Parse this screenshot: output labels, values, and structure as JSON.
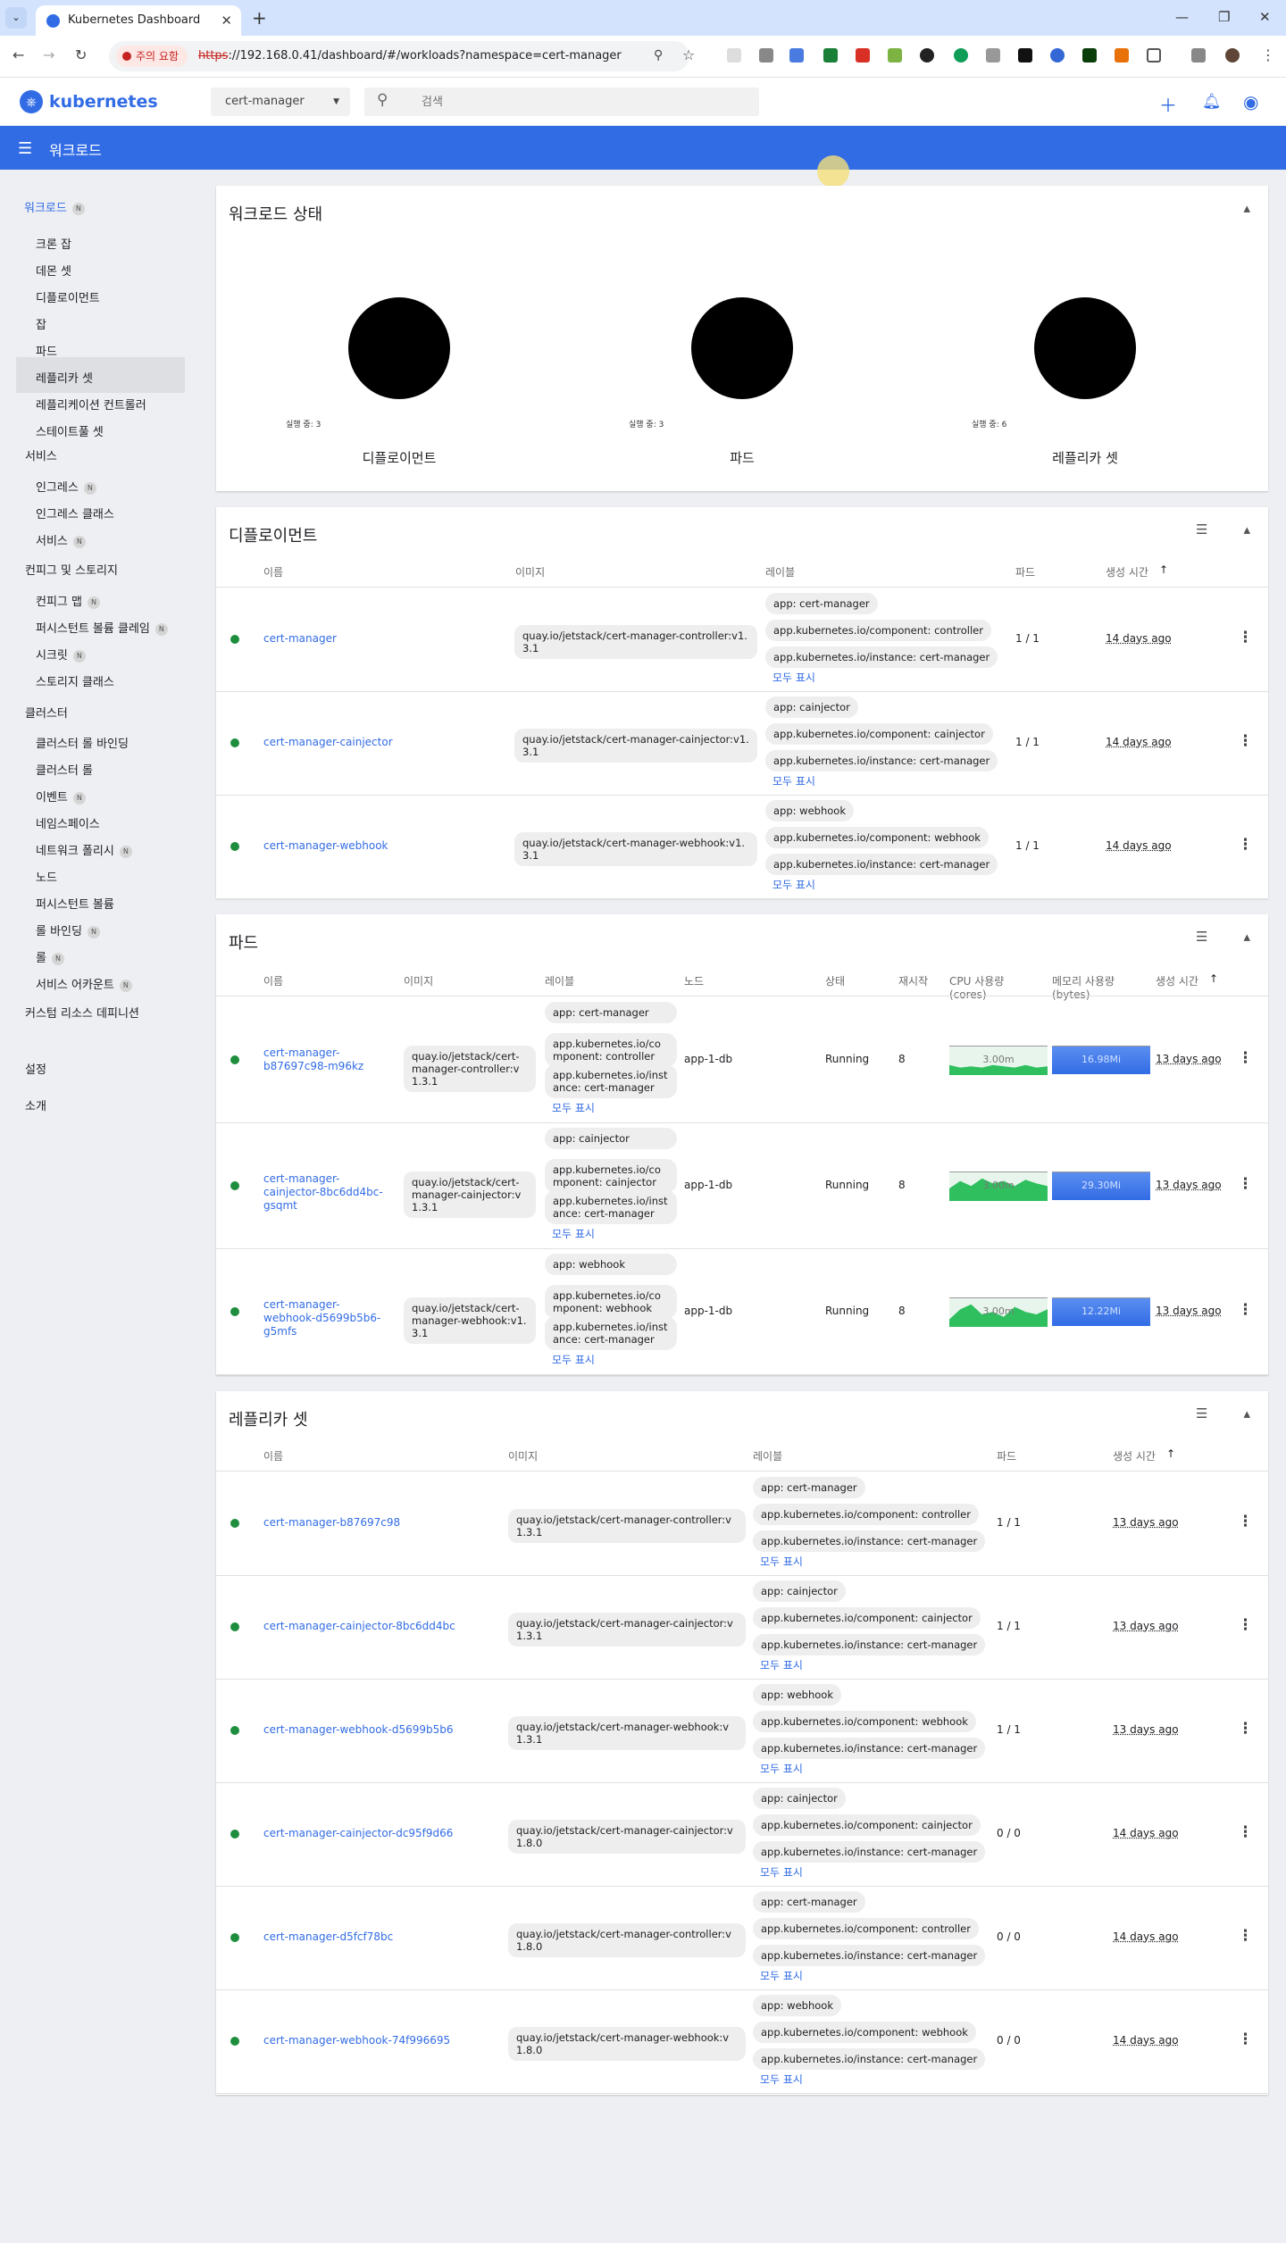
{
  "browser": {
    "tab_title": "Kubernetes Dashboard",
    "warning": "주의 요함",
    "url_scheme": "https",
    "url_rest": "://192.168.0.41/dashboard/#/workloads?namespace=cert-manager"
  },
  "header": {
    "brand": "kubernetes",
    "namespace": "cert-manager",
    "search_placeholder": "검색",
    "page_title": "워크로드"
  },
  "sidebar": {
    "active": "워크로드",
    "workloads_badge": "N",
    "workload_items": [
      "크론 잡",
      "데몬 셋",
      "디플로이먼트",
      "잡",
      "파드",
      "레플리카 셋",
      "레플리케이션 컨트롤러",
      "스테이트풀 셋"
    ],
    "service_header": "서비스",
    "service_items": [
      "인그레스",
      "인그레스 클래스",
      "서비스"
    ],
    "config_header": "컨피그 및 스토리지",
    "config_items": [
      "컨피그 맵",
      "퍼시스턴트 볼륨 클레임",
      "시크릿",
      "스토리지 클래스"
    ],
    "cluster_header": "클러스터",
    "cluster_items": [
      "클러스터 롤 바인딩",
      "클러스터 롤",
      "이벤트",
      "네임스페이스",
      "네트워크 폴리시",
      "노드",
      "퍼시스턴트 볼륨",
      "롤 바인딩",
      "롤",
      "서비스 어카운트"
    ],
    "crd": "커스텀 리소스 데피니션",
    "settings": "설정",
    "about": "소개"
  },
  "status": {
    "title": "워크로드 상태",
    "items": [
      {
        "label": "실행 중: 3",
        "name": "디플로이먼트"
      },
      {
        "label": "실행 중: 3",
        "name": "파드"
      },
      {
        "label": "실행 중: 6",
        "name": "레플리카 셋"
      }
    ]
  },
  "common": {
    "show_all": "모두 표시"
  },
  "deployments": {
    "title": "디플로이먼트",
    "cols": [
      "이름",
      "이미지",
      "레이블",
      "파드",
      "생성 시간"
    ],
    "rows": [
      {
        "name": "cert-manager",
        "image": "quay.io/jetstack/cert-manager-controller:v1.3.1",
        "labels": [
          "app: cert-manager",
          "app.kubernetes.io/component: controller",
          "app.kubernetes.io/instance: cert-manager"
        ],
        "pods": "1 / 1",
        "age": "14 days ago"
      },
      {
        "name": "cert-manager-cainjector",
        "image": "quay.io/jetstack/cert-manager-cainjector:v1.3.1",
        "labels": [
          "app: cainjector",
          "app.kubernetes.io/component: cainjector",
          "app.kubernetes.io/instance: cert-manager"
        ],
        "pods": "1 / 1",
        "age": "14 days ago"
      },
      {
        "name": "cert-manager-webhook",
        "image": "quay.io/jetstack/cert-manager-webhook:v1.3.1",
        "labels": [
          "app: webhook",
          "app.kubernetes.io/component: webhook",
          "app.kubernetes.io/instance: cert-manager"
        ],
        "pods": "1 / 1",
        "age": "14 days ago"
      }
    ]
  },
  "pods": {
    "title": "파드",
    "cols": [
      "이름",
      "이미지",
      "레이블",
      "노드",
      "상태",
      "재시작",
      "CPU 사용량 (cores)",
      "메모리 사용량 (bytes)",
      "생성 시간"
    ],
    "rows": [
      {
        "name": "cert-manager-b87697c98-m96kz",
        "image": "quay.io/jetstack/cert-manager-controller:v1.3.1",
        "labels": [
          "app: cert-manager",
          "app.kubernetes.io/component: controller",
          "app.kubernetes.io/instance: cert-manager"
        ],
        "node": "app-1-db",
        "status": "Running",
        "restarts": "8",
        "cpu": "3.00m",
        "mem": "16.98Mi",
        "age": "13 days ago"
      },
      {
        "name": "cert-manager-cainjector-8bc6dd4bc-gsqmt",
        "image": "quay.io/jetstack/cert-manager-cainjector:v1.3.1",
        "labels": [
          "app: cainjector",
          "app.kubernetes.io/component: cainjector",
          "app.kubernetes.io/instance: cert-manager"
        ],
        "node": "app-1-db",
        "status": "Running",
        "restarts": "8",
        "cpu": "3.00m",
        "mem": "29.30Mi",
        "age": "13 days ago"
      },
      {
        "name": "cert-manager-webhook-d5699b5b6-g5mfs",
        "image": "quay.io/jetstack/cert-manager-webhook:v1.3.1",
        "labels": [
          "app: webhook",
          "app.kubernetes.io/component: webhook",
          "app.kubernetes.io/instance: cert-manager"
        ],
        "node": "app-1-db",
        "status": "Running",
        "restarts": "8",
        "cpu": "3.00m",
        "mem": "12.22Mi",
        "age": "13 days ago"
      }
    ]
  },
  "replicasets": {
    "title": "레플리카 셋",
    "cols": [
      "이름",
      "이미지",
      "레이블",
      "파드",
      "생성 시간"
    ],
    "rows": [
      {
        "name": "cert-manager-b87697c98",
        "image": "quay.io/jetstack/cert-manager-controller:v1.3.1",
        "labels": [
          "app: cert-manager",
          "app.kubernetes.io/component: controller",
          "app.kubernetes.io/instance: cert-manager"
        ],
        "pods": "1 / 1",
        "age": "13 days ago"
      },
      {
        "name": "cert-manager-cainjector-8bc6dd4bc",
        "image": "quay.io/jetstack/cert-manager-cainjector:v1.3.1",
        "labels": [
          "app: cainjector",
          "app.kubernetes.io/component: cainjector",
          "app.kubernetes.io/instance: cert-manager"
        ],
        "pods": "1 / 1",
        "age": "13 days ago"
      },
      {
        "name": "cert-manager-webhook-d5699b5b6",
        "image": "quay.io/jetstack/cert-manager-webhook:v1.3.1",
        "labels": [
          "app: webhook",
          "app.kubernetes.io/component: webhook",
          "app.kubernetes.io/instance: cert-manager"
        ],
        "pods": "1 / 1",
        "age": "13 days ago"
      },
      {
        "name": "cert-manager-cainjector-dc95f9d66",
        "image": "quay.io/jetstack/cert-manager-cainjector:v1.8.0",
        "labels": [
          "app: cainjector",
          "app.kubernetes.io/component: cainjector",
          "app.kubernetes.io/instance: cert-manager"
        ],
        "pods": "0 / 0",
        "age": "14 days ago"
      },
      {
        "name": "cert-manager-d5fcf78bc",
        "image": "quay.io/jetstack/cert-manager-controller:v1.8.0",
        "labels": [
          "app: cert-manager",
          "app.kubernetes.io/component: controller",
          "app.kubernetes.io/instance: cert-manager"
        ],
        "pods": "0 / 0",
        "age": "14 days ago"
      },
      {
        "name": "cert-manager-webhook-74f996695",
        "image": "quay.io/jetstack/cert-manager-webhook:v1.8.0",
        "labels": [
          "app: webhook",
          "app.kubernetes.io/component: webhook",
          "app.kubernetes.io/instance: cert-manager"
        ],
        "pods": "0 / 0",
        "age": "14 days ago"
      }
    ]
  },
  "colors": {
    "accent": "#326ce5",
    "running": "#1e8e3e",
    "cpu_fill": "#2fbf5f",
    "mem_fill": "#326ce5"
  }
}
